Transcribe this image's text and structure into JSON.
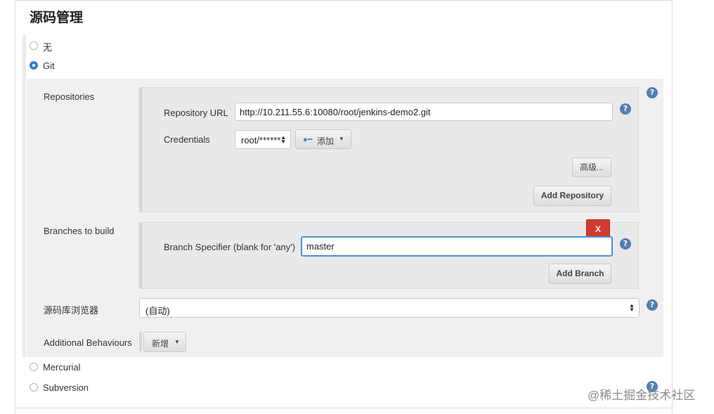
{
  "section": {
    "title": "源码管理"
  },
  "scm_options": {
    "none_label": "无",
    "git_label": "Git",
    "mercurial_label": "Mercurial",
    "subversion_label": "Subversion",
    "selected": "Git"
  },
  "git": {
    "repositories": {
      "label": "Repositories",
      "url_label": "Repository URL",
      "url_value": "http://10.211.55.6:10080/root/jenkins-demo2.git",
      "credentials_label": "Credentials",
      "credentials_value": "root/******",
      "add_label": "添加",
      "advanced_label": "高级...",
      "add_repository_label": "Add Repository"
    },
    "branches": {
      "label": "Branches to build",
      "delete_label": "X",
      "specifier_label": "Branch Specifier (blank for 'any')",
      "specifier_value": "master",
      "add_branch_label": "Add Branch"
    },
    "browser": {
      "label": "源码库浏览器",
      "value": "(自动)"
    },
    "behaviours": {
      "label": "Additional Behaviours",
      "add_label": "新增"
    }
  },
  "help_icon_glyph": "?",
  "watermark": "@稀土掘金技术社区",
  "colors": {
    "accent": "#2f7fd8",
    "help": "#4f7fb4",
    "delete": "#d4392c",
    "focus": "#4a90d9"
  }
}
